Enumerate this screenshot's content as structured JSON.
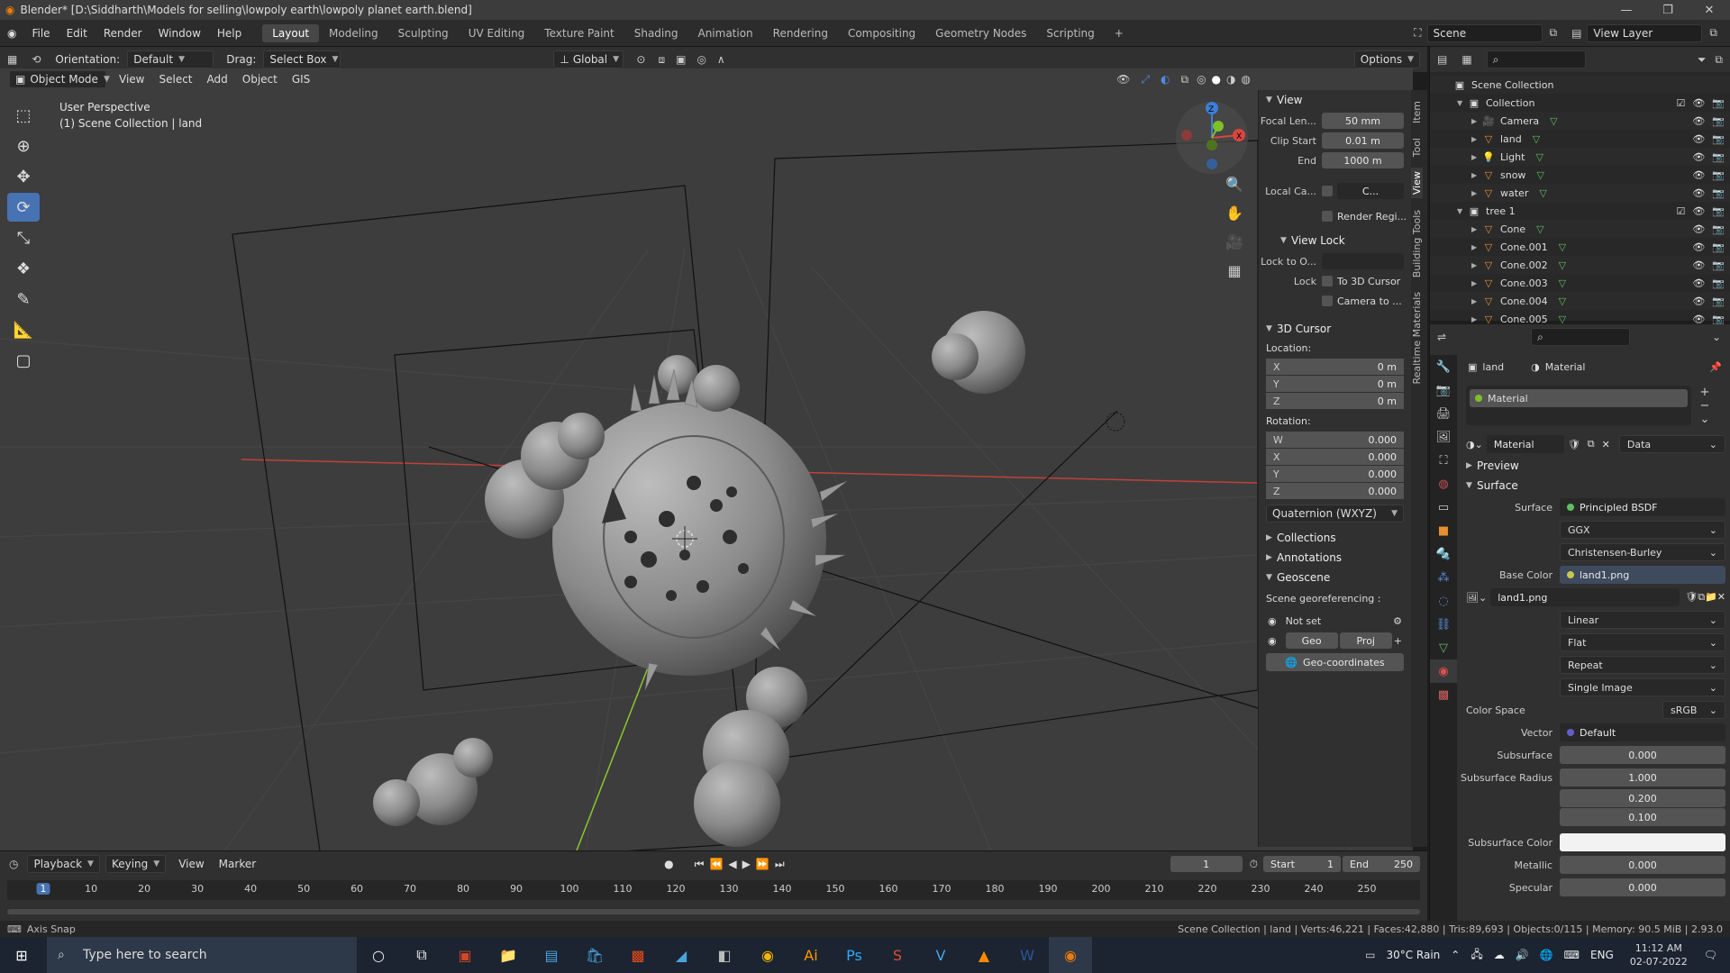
{
  "window": {
    "title": "Blender* [D:\\Siddharth\\Models for selling\\lowpoly earth\\lowpoly planet earth.blend]"
  },
  "menus": [
    "File",
    "Edit",
    "Render",
    "Window",
    "Help"
  ],
  "workspaces": [
    "Layout",
    "Modeling",
    "Sculpting",
    "UV Editing",
    "Texture Paint",
    "Shading",
    "Animation",
    "Rendering",
    "Compositing",
    "Geometry Nodes",
    "Scripting"
  ],
  "scene": {
    "name": "Scene",
    "view_layer": "View Layer"
  },
  "viewport_header": {
    "orientation_label": "Orientation:",
    "orientation_value": "Default",
    "drag_label": "Drag:",
    "drag_value": "Select Box",
    "transform": "Global",
    "options": "Options",
    "mode": "Object Mode",
    "menus": [
      "View",
      "Select",
      "Add",
      "Object",
      "GIS"
    ]
  },
  "viewport": {
    "perspective": "User Perspective",
    "context": "(1) Scene Collection | land"
  },
  "npanel": {
    "view_title": "View",
    "focal_label": "Focal Len...",
    "focal_value": "50 mm",
    "clip_start_label": "Clip Start",
    "clip_start_value": "0.01 m",
    "clip_end_label": "End",
    "clip_end_value": "1000 m",
    "local_camera_label": "Local Ca...",
    "local_camera_value": "C...",
    "render_region": "Render Regi...",
    "view_lock_title": "View Lock",
    "lock_to_label": "Lock to O...",
    "lock_label": "Lock",
    "to_cursor": "To 3D Cursor",
    "camera_to": "Camera to ...",
    "cursor_title": "3D Cursor",
    "location_label": "Location:",
    "location": [
      {
        "k": "X",
        "v": "0 m"
      },
      {
        "k": "Y",
        "v": "0 m"
      },
      {
        "k": "Z",
        "v": "0 m"
      }
    ],
    "rotation_label": "Rotation:",
    "rotation": [
      {
        "k": "W",
        "v": "0.000"
      },
      {
        "k": "X",
        "v": "0.000"
      },
      {
        "k": "Y",
        "v": "0.000"
      },
      {
        "k": "Z",
        "v": "0.000"
      }
    ],
    "rotation_mode": "Quaternion (WXYZ)",
    "collections": "Collections",
    "annotations": "Annotations",
    "geoscene": "Geoscene",
    "georef_label": "Scene georeferencing :",
    "not_set": "Not set",
    "geo_btn": "Geo",
    "proj_btn": "Proj",
    "geo_coords": "Geo-coordinates"
  },
  "sidetabs": [
    "Item",
    "Tool",
    "View",
    "Building Tools",
    "Realtime Materials"
  ],
  "outliner": {
    "root": "Scene Collection",
    "rows": [
      {
        "name": "Collection",
        "indent": 1,
        "type": "collection"
      },
      {
        "name": "Camera",
        "indent": 2,
        "type": "camera"
      },
      {
        "name": "land",
        "indent": 2,
        "type": "mesh"
      },
      {
        "name": "Light",
        "indent": 2,
        "type": "light"
      },
      {
        "name": "snow",
        "indent": 2,
        "type": "mesh"
      },
      {
        "name": "water",
        "indent": 2,
        "type": "mesh"
      },
      {
        "name": "tree 1",
        "indent": 1,
        "type": "collection"
      },
      {
        "name": "Cone",
        "indent": 2,
        "type": "mesh"
      },
      {
        "name": "Cone.001",
        "indent": 2,
        "type": "mesh"
      },
      {
        "name": "Cone.002",
        "indent": 2,
        "type": "mesh"
      },
      {
        "name": "Cone.003",
        "indent": 2,
        "type": "mesh"
      },
      {
        "name": "Cone.004",
        "indent": 2,
        "type": "mesh"
      },
      {
        "name": "Cone.005",
        "indent": 2,
        "type": "mesh"
      }
    ]
  },
  "properties": {
    "breadcrumb_object": "land",
    "breadcrumb_material": "Material",
    "slot_name": "Material",
    "material_name": "Material",
    "link": "Data",
    "preview": "Preview",
    "surface_section": "Surface",
    "surface_label": "Surface",
    "surface_value": "Principled BSDF",
    "distribution": "GGX",
    "subsurface_method": "Christensen-Burley",
    "base_color_label": "Base Color",
    "base_color_value": "land1.png",
    "image_name": "land1.png",
    "interp": "Linear",
    "projection": "Flat",
    "extension": "Repeat",
    "source": "Single Image",
    "color_space_label": "Color Space",
    "color_space_value": "sRGB",
    "vector_label": "Vector",
    "vector_value": "Default",
    "subsurface_label": "Subsurface",
    "subsurface_value": "0.000",
    "ss_radius_label": "Subsurface Radius",
    "ss_radius": [
      "1.000",
      "0.200",
      "0.100"
    ],
    "ss_color_label": "Subsurface Color",
    "metallic_label": "Metallic",
    "metallic_value": "0.000",
    "specular_label": "Specular",
    "specular_value": "0.000"
  },
  "timeline": {
    "menus": [
      "Playback",
      "Keying",
      "View",
      "Marker"
    ],
    "current_frame": "1",
    "start_label": "Start",
    "start": "1",
    "end_label": "End",
    "end": "250",
    "ticks": [
      "1",
      "10",
      "20",
      "30",
      "40",
      "50",
      "60",
      "70",
      "80",
      "90",
      "100",
      "110",
      "120",
      "130",
      "140",
      "150",
      "160",
      "170",
      "180",
      "190",
      "200",
      "210",
      "220",
      "230",
      "240",
      "250"
    ]
  },
  "status": {
    "left": "Axis Snap",
    "right": "Scene Collection | land | Verts:46,221 | Faces:42,880 | Tris:89,693 | Objects:0/115 | Memory: 90.5 MiB | 2.93.0"
  },
  "taskbar": {
    "search_placeholder": "Type here to search",
    "weather": "30°C Rain",
    "lang": "ENG",
    "time": "11:12 AM",
    "date": "02-07-2022"
  },
  "colors": {
    "accent": "#4772b3",
    "x_axis": "#d9463f",
    "y_axis": "#7fbf2a",
    "z_axis": "#3c7fd6",
    "viewport_bg": "#3d3d3d"
  }
}
